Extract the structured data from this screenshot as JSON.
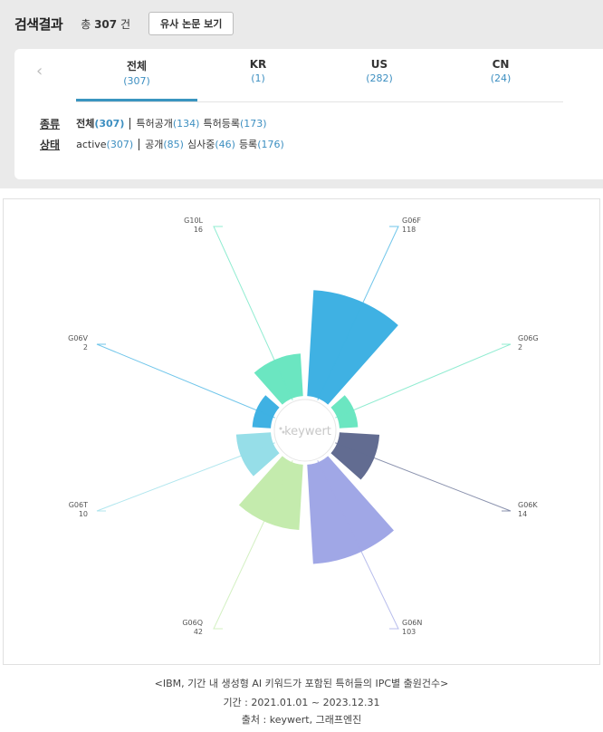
{
  "header": {
    "title": "검색결과",
    "total_prefix": "총",
    "total_count": "307",
    "total_suffix": "건",
    "similar_button": "유사 논문 보기"
  },
  "tabs": [
    {
      "label": "전체",
      "count": "(307)",
      "active": true
    },
    {
      "label": "KR",
      "count": "(1)",
      "active": false
    },
    {
      "label": "US",
      "count": "(282)",
      "active": false
    },
    {
      "label": "CN",
      "count": "(24)",
      "active": false
    }
  ],
  "filters": {
    "type": {
      "key": "종류",
      "options": [
        {
          "label": "전체",
          "count": "(307)",
          "selected": true
        },
        {
          "label": "특허공개",
          "count": "(134)",
          "selected": false
        },
        {
          "label": "특허등록",
          "count": "(173)",
          "selected": false
        }
      ]
    },
    "status": {
      "key": "상태",
      "options": [
        {
          "label": "active",
          "count": "(307)",
          "selected": false
        },
        {
          "label": "공개",
          "count": "(85)",
          "selected": false
        },
        {
          "label": "심사중",
          "count": "(46)",
          "selected": false
        },
        {
          "label": "등록",
          "count": "(176)",
          "selected": false
        }
      ]
    }
  },
  "chart_data": {
    "type": "polar-area",
    "center_label": "keywert",
    "series": [
      {
        "code": "G06F",
        "value": 118,
        "color": "#3fb1e3"
      },
      {
        "code": "G06G",
        "value": 2,
        "color": "#6be6c1"
      },
      {
        "code": "G06K",
        "value": 14,
        "color": "#626c91"
      },
      {
        "code": "G06N",
        "value": 103,
        "color": "#a0a7e6"
      },
      {
        "code": "G06Q",
        "value": 42,
        "color": "#c4ebad"
      },
      {
        "code": "G06T",
        "value": 10,
        "color": "#96dee8"
      },
      {
        "code": "G06V",
        "value": 2,
        "color": "#3fb1e3"
      },
      {
        "code": "G10L",
        "value": 16,
        "color": "#6be6c1"
      }
    ]
  },
  "caption": {
    "line1": "<IBM, 기간 내 생성형 AI 키워드가 포함된 특허들의 IPC별 출원건수>",
    "line2": "기간 : 2021.01.01 ~ 2023.12.31",
    "line3": "출처 : keywert, 그래프엔진"
  }
}
